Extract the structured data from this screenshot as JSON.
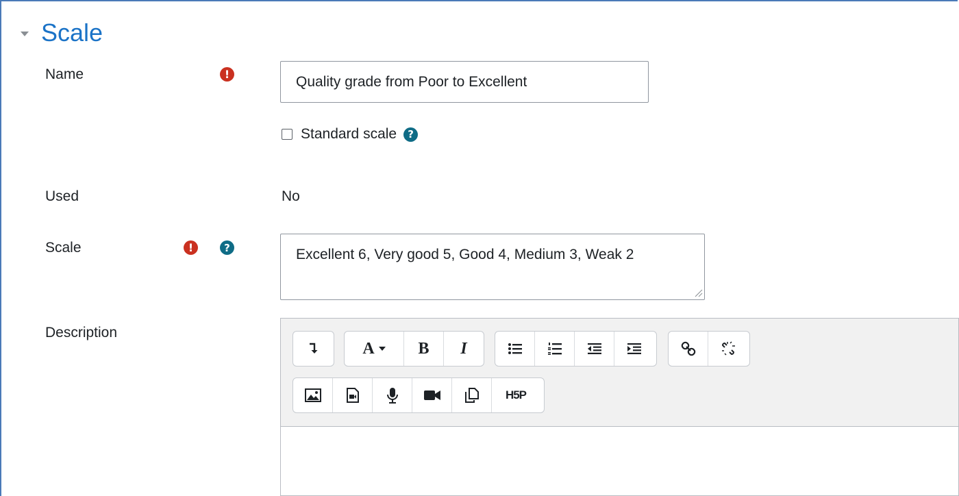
{
  "section": {
    "title": "Scale"
  },
  "form": {
    "name_label": "Name",
    "name_value": "Quality grade from Poor to Excellent",
    "standard_scale_label": "Standard scale",
    "used_label": "Used",
    "used_value": "No",
    "scale_label": "Scale",
    "scale_value": "Excellent 6, Very good 5, Good 4, Medium 3, Weak 2",
    "description_label": "Description"
  },
  "icons": {
    "required": "!",
    "help": "?",
    "font_glyph": "A",
    "bold_glyph": "B",
    "italic_glyph": "I",
    "h5p_glyph": "H5P"
  },
  "colors": {
    "accent": "#1b73c7",
    "required": "#ca3120",
    "help": "#0f6c86"
  }
}
